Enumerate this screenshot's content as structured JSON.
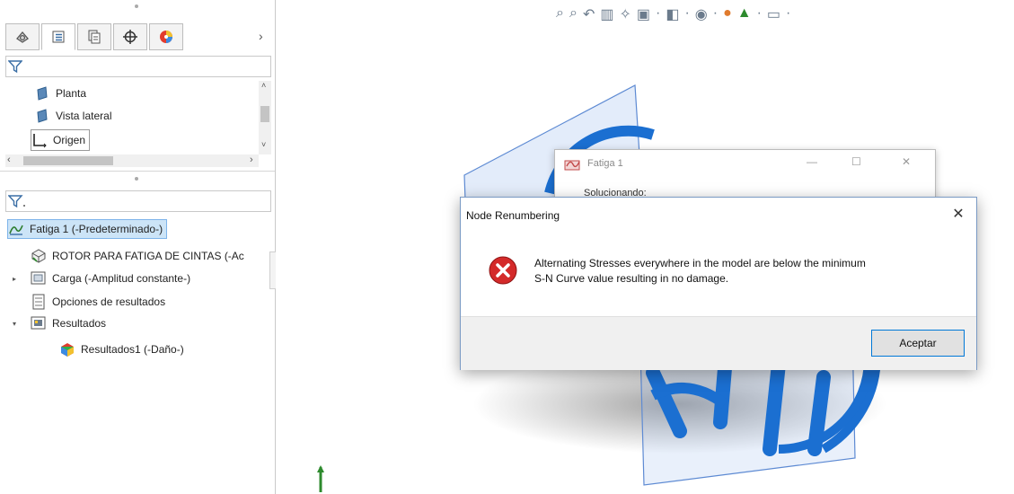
{
  "feature_manager": {
    "tabs": [
      {
        "name": "feature-manager-tab-icon"
      },
      {
        "name": "property-manager-tab-icon"
      },
      {
        "name": "configuration-manager-tab-icon"
      },
      {
        "name": "dimxpert-tab-icon"
      },
      {
        "name": "display-manager-tab-icon"
      }
    ],
    "top_tree": [
      {
        "label": "Planta",
        "icon": "plane-icon"
      },
      {
        "label": "Vista lateral",
        "icon": "plane-icon"
      },
      {
        "label": "Origen",
        "icon": "origin-icon"
      }
    ]
  },
  "simulation_tree": {
    "study": "Fatiga 1 (-Predeterminado-)",
    "items": [
      {
        "label": "ROTOR PARA FATIGA DE CINTAS (-Ac",
        "icon": "part-icon"
      },
      {
        "label": "Carga (-Amplitud constante-)",
        "icon": "load-folder-icon"
      },
      {
        "label": "Opciones de resultados",
        "icon": "result-options-icon"
      },
      {
        "label": "Resultados",
        "icon": "results-folder-icon"
      },
      {
        "label": "Resultados1 (-Daño-)",
        "icon": "result-plot-icon"
      }
    ]
  },
  "background_window": {
    "title": "Fatiga 1",
    "status": "Solucionando:"
  },
  "dialog": {
    "title": "Node Renumbering",
    "close_symbol": "✕",
    "message_line1": "Alternating Stresses everywhere in the model are below the minimum",
    "message_line2": "S-N Curve value resulting in no damage.",
    "ok_label": "Aceptar",
    "icon": "error-icon"
  },
  "colors": {
    "accent": "#0078d7",
    "error_red": "#d42a2a",
    "model_blue": "#1b6fd1"
  }
}
